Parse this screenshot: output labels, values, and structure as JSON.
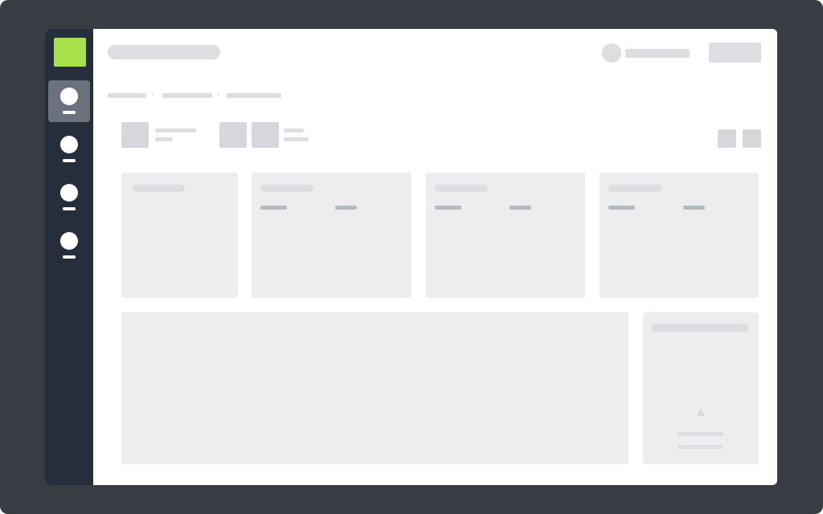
{
  "colors": {
    "desktop_bg": "#373d42",
    "window_bg": "#ffffff",
    "sidebar_bg": "#262d3b",
    "sidebar_active_bg": "#6b717d",
    "sidebar_icon": "#ffffff",
    "logo": "#a8e04a",
    "placeholder_light": "#dcdee2",
    "placeholder_mid": "#d5d7dc",
    "card_bg": "#ededef",
    "card_line": "#b5b9c2"
  },
  "sidebar": {
    "logo_icon": "logo-icon",
    "items": [
      {
        "icon": "nav-icon",
        "active": true
      },
      {
        "icon": "nav-icon",
        "active": false
      },
      {
        "icon": "nav-icon",
        "active": false
      },
      {
        "icon": "nav-icon",
        "active": false
      }
    ]
  },
  "header": {
    "title": "",
    "user": {
      "avatar_icon": "avatar-icon",
      "name": ""
    },
    "action_button": ""
  },
  "breadcrumb": {
    "items": [
      "",
      "",
      ""
    ],
    "separator": "›"
  },
  "toolbar": {
    "view_toggle_icons": [
      "grid-view-icon",
      "list-view-icon"
    ]
  },
  "stat_cards": [
    {
      "title": "",
      "values": []
    },
    {
      "title": "",
      "values": [
        "",
        ""
      ]
    },
    {
      "title": "",
      "values": [
        "",
        ""
      ]
    },
    {
      "title": "",
      "values": [
        "",
        ""
      ]
    }
  ],
  "main_panel": {
    "content": ""
  },
  "side_panel": {
    "title": "",
    "icon": "up-arrow-icon",
    "lines": [
      "",
      ""
    ]
  }
}
